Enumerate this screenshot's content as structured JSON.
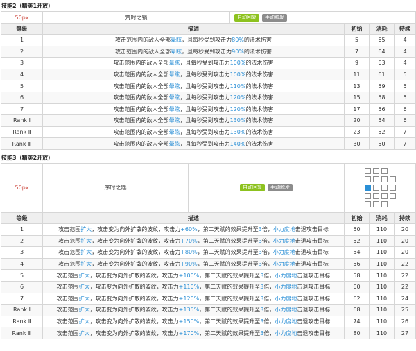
{
  "skill2": {
    "title": "技能2（精英1开放）",
    "icon": "50px",
    "name": "荒时之锁",
    "tags": [
      "自动回复",
      "手动触发"
    ],
    "headers": [
      "等级",
      "描述",
      "初始",
      "消耗",
      "持续"
    ],
    "rows": [
      {
        "level": "1",
        "d1": "攻击范围内的敌人全部",
        "d2": "晕眩",
        "d3": "，且每秒受到攻击力",
        "d4": "80%",
        "d5": "的法术伤害",
        "init": "5",
        "cost": "65",
        "dur": "4"
      },
      {
        "level": "2",
        "d1": "攻击范围内的敌人全部",
        "d2": "晕眩",
        "d3": "，且每秒受到攻击力",
        "d4": "90%",
        "d5": "的法术伤害",
        "init": "7",
        "cost": "64",
        "dur": "4"
      },
      {
        "level": "3",
        "d1": "攻击范围内的敌人全部",
        "d2": "晕眩",
        "d3": "，且每秒受到攻击力",
        "d4": "100%",
        "d5": "的法术伤害",
        "init": "9",
        "cost": "63",
        "dur": "4"
      },
      {
        "level": "4",
        "d1": "攻击范围内的敌人全部",
        "d2": "晕眩",
        "d3": "，且每秒受到攻击力",
        "d4": "100%",
        "d5": "的法术伤害",
        "init": "11",
        "cost": "61",
        "dur": "5"
      },
      {
        "level": "5",
        "d1": "攻击范围内的敌人全部",
        "d2": "晕眩",
        "d3": "，且每秒受到攻击力",
        "d4": "110%",
        "d5": "的法术伤害",
        "init": "13",
        "cost": "59",
        "dur": "5"
      },
      {
        "level": "6",
        "d1": "攻击范围内的敌人全部",
        "d2": "晕眩",
        "d3": "，且每秒受到攻击力",
        "d4": "120%",
        "d5": "的法术伤害",
        "init": "15",
        "cost": "58",
        "dur": "5"
      },
      {
        "level": "7",
        "d1": "攻击范围内的敌人全部",
        "d2": "晕眩",
        "d3": "，且每秒受到攻击力",
        "d4": "120%",
        "d5": "的法术伤害",
        "init": "17",
        "cost": "56",
        "dur": "6"
      },
      {
        "level": "Rank Ⅰ",
        "d1": "攻击范围内的敌人全部",
        "d2": "晕眩",
        "d3": "，且每秒受到攻击力",
        "d4": "130%",
        "d5": "的法术伤害",
        "init": "20",
        "cost": "54",
        "dur": "6"
      },
      {
        "level": "Rank Ⅱ",
        "d1": "攻击范围内的敌人全部",
        "d2": "晕眩",
        "d3": "，且每秒受到攻击力",
        "d4": "130%",
        "d5": "的法术伤害",
        "init": "23",
        "cost": "52",
        "dur": "7"
      },
      {
        "level": "Rank Ⅲ",
        "d1": "攻击范围内的敌人全部",
        "d2": "晕眩",
        "d3": "，且每秒受到攻击力",
        "d4": "140%",
        "d5": "的法术伤害",
        "init": "30",
        "cost": "50",
        "dur": "7"
      }
    ]
  },
  "skill3": {
    "title": "技能3（精英2开放）",
    "icon": "50px",
    "name": "序时之匙",
    "tags": [
      "自动回复",
      "手动触发"
    ],
    "headers": [
      "等级",
      "描述",
      "初始",
      "消耗",
      "持续"
    ],
    "rows": [
      {
        "level": "1",
        "a1": "攻击范围",
        "a2": "扩大",
        "a3": "，攻击变为向外扩散的波纹，攻击力",
        "a4": "+60%",
        "a5": "，第二天赋的效果提升至",
        "a6": "3",
        "a7": "倍，",
        "a8": "小力度地",
        "a9": "击退攻击目标",
        "init": "50",
        "cost": "110",
        "dur": "20"
      },
      {
        "level": "2",
        "a1": "攻击范围",
        "a2": "扩大",
        "a3": "，攻击变为向外扩散的波纹，攻击力",
        "a4": "+70%",
        "a5": "，第二天赋的效果提升至",
        "a6": "3",
        "a7": "倍，",
        "a8": "小力度地",
        "a9": "击退攻击目标",
        "init": "52",
        "cost": "110",
        "dur": "20"
      },
      {
        "level": "3",
        "a1": "攻击范围",
        "a2": "扩大",
        "a3": "，攻击变为向外扩散的波纹，攻击力",
        "a4": "+80%",
        "a5": "，第二天赋的效果提升至",
        "a6": "3",
        "a7": "倍，",
        "a8": "小力度地",
        "a9": "击退攻击目标",
        "init": "54",
        "cost": "110",
        "dur": "20"
      },
      {
        "level": "4",
        "a1": "攻击范围",
        "a2": "扩大",
        "a3": "，攻击变为向外扩散的波纹，攻击力",
        "a4": "+90%",
        "a5": "，第二天赋的效果提升至",
        "a6": "3",
        "a7": "倍，",
        "a8": "小力度地",
        "a9": "击退攻击目标",
        "init": "56",
        "cost": "110",
        "dur": "22"
      },
      {
        "level": "5",
        "a1": "攻击范围",
        "a2": "扩大",
        "a3": "，攻击变为向外扩散的波纹，攻击力",
        "a4": "+100%",
        "a5": "，第二天赋的效果提升至",
        "a6": "3",
        "a7": "倍，",
        "a8": "小力度地",
        "a9": "击退攻击目标",
        "init": "58",
        "cost": "110",
        "dur": "22"
      },
      {
        "level": "6",
        "a1": "攻击范围",
        "a2": "扩大",
        "a3": "，攻击变为向外扩散的波纹，攻击力",
        "a4": "+110%",
        "a5": "，第二天赋的效果提升至",
        "a6": "3",
        "a7": "倍，",
        "a8": "小力度地",
        "a9": "击退攻击目标",
        "init": "60",
        "cost": "110",
        "dur": "22"
      },
      {
        "level": "7",
        "a1": "攻击范围",
        "a2": "扩大",
        "a3": "，攻击变为向外扩散的波纹，攻击力",
        "a4": "+120%",
        "a5": "，第二天赋的效果提升至",
        "a6": "3",
        "a7": "倍，",
        "a8": "小力度地",
        "a9": "击退攻击目标",
        "init": "62",
        "cost": "110",
        "dur": "24"
      },
      {
        "level": "Rank Ⅰ",
        "a1": "攻击范围",
        "a2": "扩大",
        "a3": "，攻击变为向外扩散的波纹，攻击力",
        "a4": "+135%",
        "a5": "，第二天赋的效果提升至",
        "a6": "3",
        "a7": "倍，",
        "a8": "小力度地",
        "a9": "击退攻击目标",
        "init": "68",
        "cost": "110",
        "dur": "25"
      },
      {
        "level": "Rank Ⅱ",
        "a1": "攻击范围",
        "a2": "扩大",
        "a3": "，攻击变为向外扩散的波纹，攻击力",
        "a4": "+150%",
        "a5": "，第二天赋的效果提升至",
        "a6": "3",
        "a7": "倍，",
        "a8": "小力度地",
        "a9": "击退攻击目标",
        "init": "74",
        "cost": "110",
        "dur": "26"
      },
      {
        "level": "Rank Ⅲ",
        "a1": "攻击范围",
        "a2": "扩大",
        "a3": "，攻击变为向外扩散的波纹，攻击力",
        "a4": "+170%",
        "a5": "，第二天赋的效果提升至",
        "a6": "3",
        "a7": "倍，",
        "a8": "小力度地",
        "a9": "击退攻击目标",
        "init": "80",
        "cost": "110",
        "dur": "27"
      }
    ]
  },
  "colors": {
    "highlight": "#2a8fd6",
    "auto_tag": "#8dc21f",
    "manual_tag": "#8c8c8c",
    "icon_text": "#d0534a"
  }
}
